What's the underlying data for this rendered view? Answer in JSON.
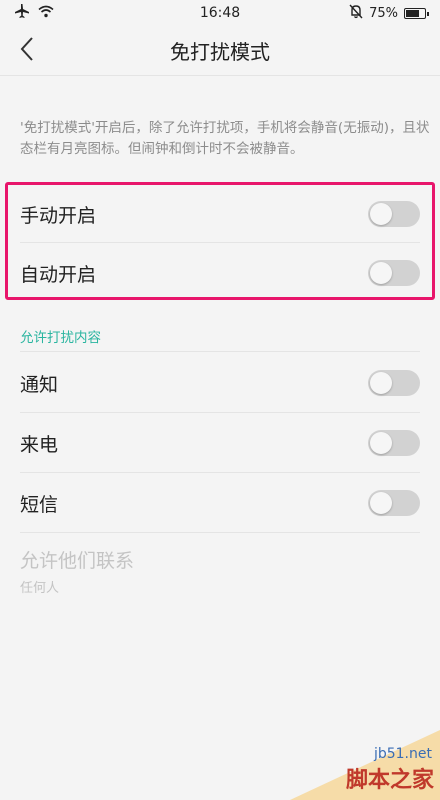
{
  "status_bar": {
    "time": "16:48",
    "battery_text": "75%",
    "battery_level": 0.75,
    "icons": [
      "airplane-icon",
      "wifi-icon",
      "mute-bell-icon",
      "battery-icon"
    ]
  },
  "nav": {
    "title": "免打扰模式",
    "back_icon": "chevron-left-icon"
  },
  "description": "'免打扰模式'开启后，除了允许打扰项，手机将会静音(无振动)，且状态栏有月亮图标。但闹钟和倒计时不会被静音。",
  "highlight_color": "#e8156b",
  "toggles": {
    "manual": {
      "label": "手动开启",
      "on": false
    },
    "auto": {
      "label": "自动开启",
      "on": false
    }
  },
  "allow_section": {
    "header": "允许打扰内容",
    "header_color": "#2bb5a0",
    "items": [
      {
        "label": "通知",
        "on": false
      },
      {
        "label": "来电",
        "on": false
      },
      {
        "label": "短信",
        "on": false
      }
    ]
  },
  "allow_contacts": {
    "title": "允许他们联系",
    "value": "任何人"
  },
  "watermark": {
    "domain": "jb51.net",
    "name": "脚本之家"
  }
}
